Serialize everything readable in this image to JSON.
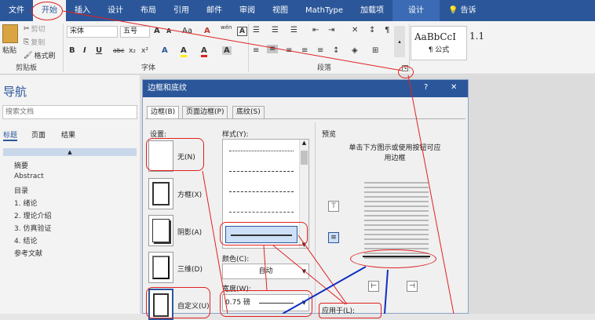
{
  "ribbon_tabs": [
    "文件",
    "开始",
    "插入",
    "设计",
    "布局",
    "引用",
    "邮件",
    "审阅",
    "视图",
    "MathType",
    "加载项",
    "设计",
    "告诉"
  ],
  "clipboard": {
    "paste": "粘贴",
    "cut": "剪切",
    "copy": "复制",
    "format_painter": "格式刷",
    "group": "剪贴板"
  },
  "font": {
    "name": "宋体",
    "size": "五号",
    "group": "字体",
    "size_up": "A",
    "size_down": "A",
    "aa": "Aa",
    "wen": "wén",
    "clear": "A",
    "bold": "B",
    "italic": "I",
    "underline": "U",
    "strike": "abc",
    "sub": "x₂",
    "sup": "x²",
    "effects": "A",
    "highlight": "A",
    "color": "A",
    "charbox": "A"
  },
  "paragraph": {
    "group": "段落"
  },
  "styles": {
    "style1": "AaBbCcI",
    "style1_name": "¶ 公式",
    "style2": "1.1"
  },
  "nav": {
    "title": "导航",
    "search_placeholder": "搜索文档",
    "tabs": [
      "标题",
      "页面",
      "结果"
    ],
    "items": [
      "摘要",
      "Abstract",
      "目录",
      "1. 绪论",
      "2. 理论介绍",
      "3. 仿真验证",
      "4. 结论",
      "参考文献"
    ]
  },
  "dialog": {
    "title": "边框和底纹",
    "help": "?",
    "close": "✕",
    "tabs": [
      "边框(B)",
      "页面边框(P)",
      "底纹(S)"
    ],
    "setting_label": "设置:",
    "settings": [
      "无(N)",
      "方框(X)",
      "阴影(A)",
      "三维(D)",
      "自定义(U)"
    ],
    "style_label": "样式(Y):",
    "color_label": "颜色(C):",
    "color_value": "自动",
    "width_label": "宽度(W):",
    "width_value": "0.75 磅",
    "preview_label": "预览",
    "preview_hint": "单击下方图示或使用按钮可应用边框",
    "apply_label": "应用于(L):"
  },
  "colors": {
    "accent": "#2b579a",
    "annotation": "#e02020",
    "arrow_blue": "#1030c0"
  }
}
